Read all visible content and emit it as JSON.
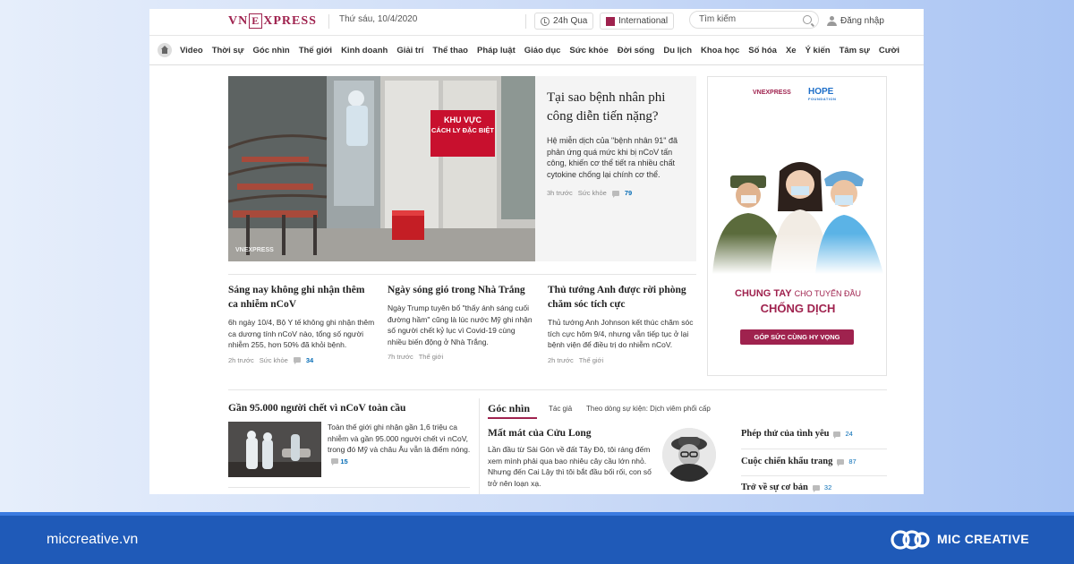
{
  "header": {
    "logo": "VNEXPRESS",
    "date": "Thứ sáu, 10/4/2020",
    "recent": "24h Qua",
    "international": "International",
    "search_placeholder": "Tìm kiếm",
    "login": "Đăng nhập"
  },
  "nav": [
    "Video",
    "Thời sự",
    "Góc nhìn",
    "Thế giới",
    "Kinh doanh",
    "Giải trí",
    "Thể thao",
    "Pháp luật",
    "Giáo dục",
    "Sức khỏe",
    "Đời sống",
    "Du lịch",
    "Khoa học",
    "Số hóa",
    "Xe",
    "Ý kiến",
    "Tâm sự",
    "Cười"
  ],
  "hero": {
    "sign_line1": "KHU VỰC",
    "sign_line2": "CÁCH LY ĐẶC BIỆT",
    "watermark": "VNEXPRESS",
    "title": "Tại sao bệnh nhân phi công diễn tiến nặng?",
    "desc": "Hệ miễn dịch của \"bệnh nhân 91\" đã phản ứng quá mức khi bị nCoV tấn công, khiến cơ thể tiết ra nhiều chất cytokine chống lại chính cơ thể.",
    "time": "3h trước",
    "category": "Sức khỏe",
    "comments": "79"
  },
  "articles": [
    {
      "title": "Sáng nay không ghi nhận thêm ca nhiễm nCoV",
      "desc": "6h ngày 10/4, Bộ Y tế không ghi nhận thêm ca dương tính nCoV nào, tổng số người nhiễm 255, hơn 50% đã khỏi bệnh.",
      "time": "2h trước",
      "category": "Sức khỏe",
      "comments": "34"
    },
    {
      "title": "Ngày sóng gió trong Nhà Trắng",
      "desc": "Ngày Trump tuyên bố \"thấy ánh sáng cuối đường hầm\" cũng là lúc nước Mỹ ghi nhận số người chết kỷ lục vì Covid-19 cùng nhiều biến động ở Nhà Trắng.",
      "time": "7h trước",
      "category": "Thế giới"
    },
    {
      "title": "Thủ tướng Anh được rời phòng chăm sóc tích cực",
      "desc": "Thủ tướng Anh Johnson kết thúc chăm sóc tích cực hôm 9/4, nhưng vẫn tiếp tục ở lại bệnh viện để điều trị do nhiễm nCoV.",
      "time": "2h trước",
      "category": "Thế giới"
    }
  ],
  "ad": {
    "logo": "VNEXPRESS",
    "hope": "HOPE",
    "hope_sub": "FOUNDATION",
    "line1": "CHUNG TAY",
    "line1_small": "CHO TUYẾN ĐẦU",
    "line2": "CHỐNG DỊCH",
    "button": "GÓP SỨC CÙNG HY VỌNG"
  },
  "bottom": {
    "title": "Gần 95.000 người chết vì nCoV toàn cầu",
    "desc": "Toàn thế giới ghi nhận gần 1,6 triệu ca nhiễm và gần 95.000 người chết vì nCoV, trong đó Mỹ và châu Âu vẫn là điểm nóng.",
    "comments": "15"
  },
  "goc_nhin": {
    "title": "Góc nhìn",
    "tab_author": "Tác giả",
    "tab_event": "Theo dòng sự kiện: Dịch viêm phổi cấp",
    "article_title": "Mất mát của Cửu Long",
    "article_desc": "Lần đầu từ Sài Gòn về đất Tây Đô, tôi ráng đếm xem mình phải qua bao nhiêu cây cầu lớn nhỏ. Nhưng đến Cai Lậy thì tôi bắt đầu bối rối, con số trở nên loạn xạ."
  },
  "side": [
    {
      "title": "Phép thử của tình yêu",
      "comments": "24"
    },
    {
      "title": "Cuộc chiến khẩu trang",
      "comments": "87"
    },
    {
      "title": "Trở về sự cơ bản",
      "comments": "32"
    }
  ],
  "footer": {
    "site": "miccreative.vn",
    "brand": "MIC CREATIVE"
  },
  "colors": {
    "brand": "#9f224e",
    "footer": "#1f5ab8",
    "link": "#076db6"
  }
}
